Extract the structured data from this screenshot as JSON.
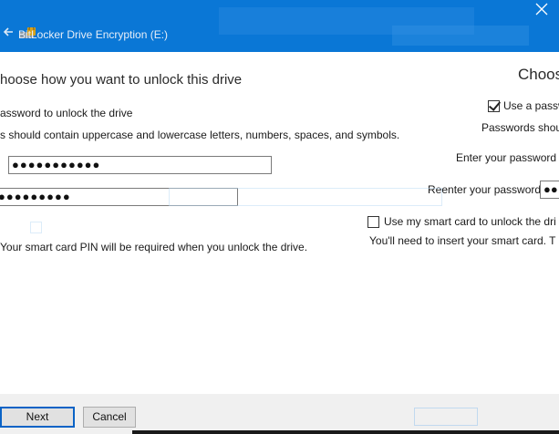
{
  "window": {
    "title": "BitLocker Drive Encryption (E:)",
    "accent": "#0a77d6"
  },
  "icons": {
    "back": "back-arrow-icon",
    "app": "bitlocker-drive-icon",
    "close": "close-icon"
  },
  "left": {
    "heading": "hoose how you want to unlock this drive",
    "password_option": "assword to unlock the drive",
    "password_hint": "s should contain uppercase and lowercase letters, numbers, spaces, and symbols.",
    "password_value": "●●●●●●●●●●●",
    "reenter_value": "●●●●●●●●●",
    "smartcard_hint": "Your smart card PIN will be required when you unlock the drive.",
    "next_label": "Next",
    "cancel_label": "Cancel"
  },
  "right": {
    "heading": "Choos",
    "password_checkbox_label": "Use a passw",
    "password_checked": true,
    "password_hint": "Passwords shou",
    "enter_label": "Enter your password",
    "reenter_label": "Reenter your password",
    "reenter_value": "●●",
    "smartcard_checkbox_label": "Use my smart card to unlock the dri",
    "smartcard_checked": false,
    "smartcard_hint": "You'll need to insert your smart card. T"
  }
}
